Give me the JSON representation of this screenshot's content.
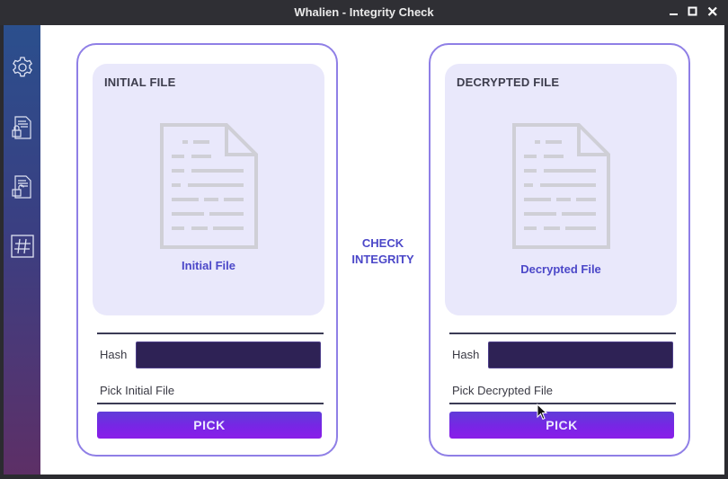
{
  "window": {
    "title": "Whalien - Integrity Check"
  },
  "window_controls": [
    "minimize-icon",
    "maximize-icon",
    "close-icon"
  ],
  "sidebar": {
    "items": [
      {
        "icon": "gear-icon"
      },
      {
        "icon": "encrypt-file-icon"
      },
      {
        "icon": "decrypt-file-icon"
      },
      {
        "icon": "hash-icon"
      }
    ]
  },
  "check_integrity": {
    "line1": "CHECK",
    "line2": "INTEGRITY"
  },
  "initial": {
    "header": "INITIAL FILE",
    "file_label": "Initial File",
    "hash_label": "Hash",
    "hash_value": "",
    "pick_label": "Pick Initial File",
    "pick_button": "PICK"
  },
  "decrypted": {
    "header": "DECRYPTED FILE",
    "file_label": "Decrypted File",
    "hash_label": "Hash",
    "hash_value": "",
    "pick_label": "Pick Decrypted File",
    "pick_button": "PICK"
  },
  "colors": {
    "accent": "#4b47c8",
    "card_border": "#8f7fe6",
    "drop_bg": "#e9e8fb",
    "button_gradient_start": "#5f3cd8",
    "button_gradient_end": "#8a1ee8",
    "hash_field_bg": "#2e2255"
  }
}
